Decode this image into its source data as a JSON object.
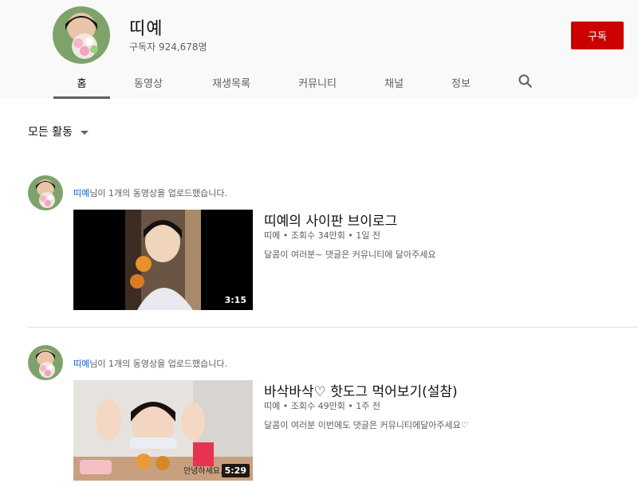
{
  "channel": {
    "name": "띠예",
    "subscribers": "구독자 924,678명",
    "subscribe_label": "구독"
  },
  "tabs": [
    {
      "label": "홈",
      "active": true
    },
    {
      "label": "동영상"
    },
    {
      "label": "재생목록"
    },
    {
      "label": "커뮤니티"
    },
    {
      "label": "채널"
    },
    {
      "label": "정보"
    }
  ],
  "sort_label": "모든 활동",
  "activities": [
    {
      "channel": "띠예",
      "action": "님이 1개의 동영상을 업로드했습니다.",
      "video": {
        "title": "띠예의 사이판 브이로그",
        "meta": "띠예 • 조회수 34만회 • 1일 전",
        "description": "달콤이 여러분~ 댓글은 커뮤니티에 달아주세요",
        "duration": "3:15"
      }
    },
    {
      "channel": "띠예",
      "action": "님이 1개의 동영상을 업로드했습니다.",
      "video": {
        "title": "바삭바삭♡ 핫도그 먹어보기(설참)",
        "meta": "띠예 • 조회수 49만회 • 1주 전",
        "description": "달콤이 여러분 이번에도 댓글은 커뮤니티에달아주세요♡",
        "duration": "5:29",
        "thumb_caption": "안녕하세요."
      }
    }
  ],
  "colors": {
    "subscribe": "#cc0000",
    "link": "#065fd4",
    "secondary_text": "#606060"
  }
}
